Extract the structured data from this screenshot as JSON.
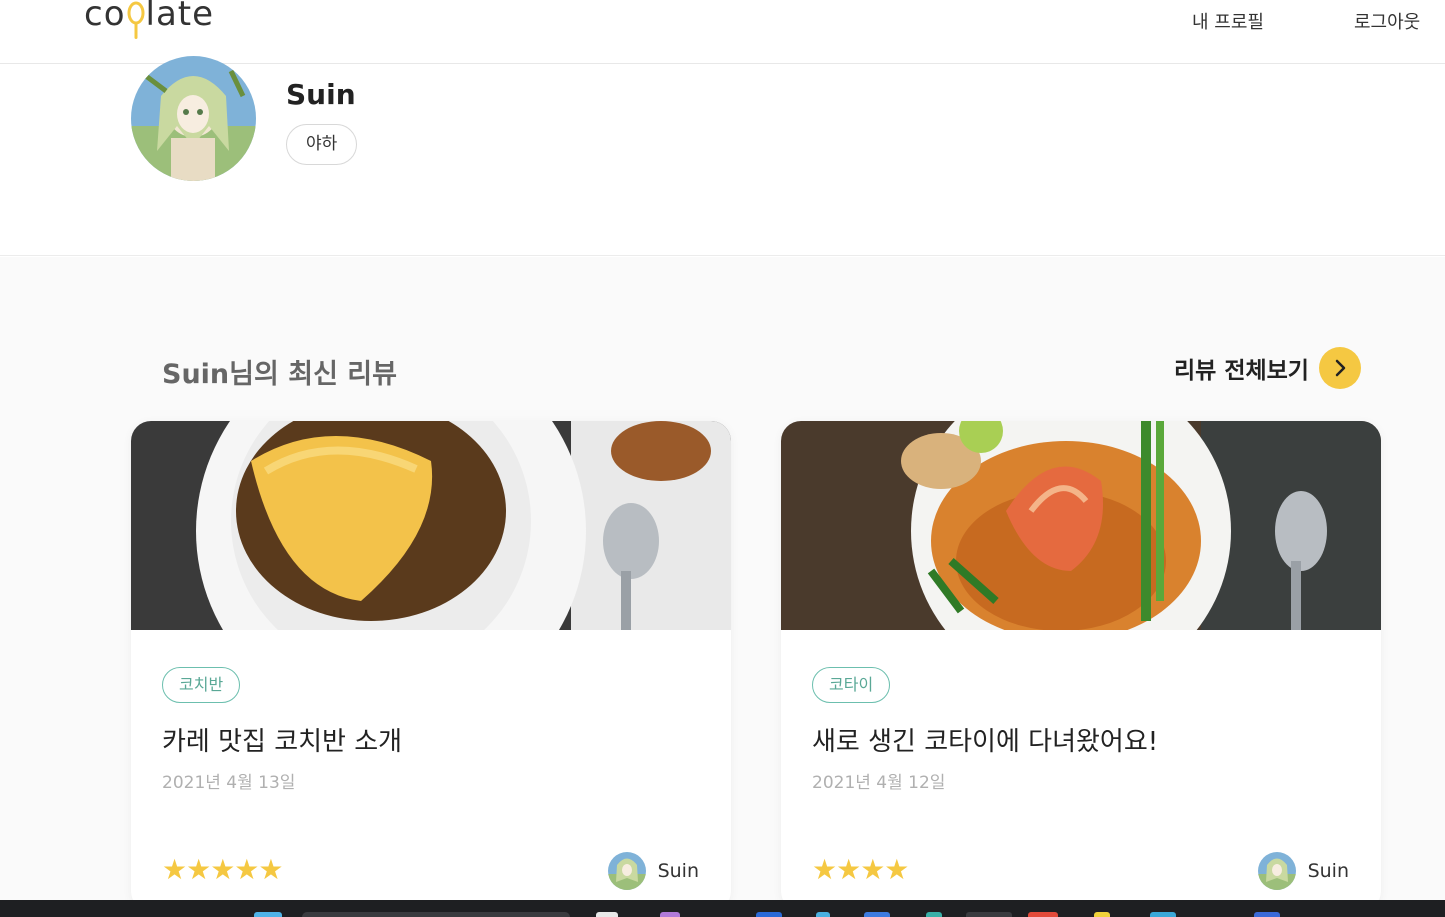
{
  "header": {
    "logo": "coolate",
    "nav": {
      "profile": "내 프로필",
      "logout": "로그아웃"
    }
  },
  "profile": {
    "name": "Suin",
    "bio": "야하"
  },
  "reviews": {
    "title": "Suin님의 최신 리뷰",
    "see_all_label": "리뷰 전체보기",
    "cards": [
      {
        "tag": "코치반",
        "title": "카레 맛집 코치반 소개",
        "date": "2021년 4월 13일",
        "stars": "★★★★★",
        "rating": 5,
        "author": "Suin"
      },
      {
        "tag": "코타이",
        "title": "새로 생긴 코타이에 다녀왔어요!",
        "date": "2021년 4월 12일",
        "stars": "★★★★",
        "rating": 4,
        "author": "Suin"
      }
    ]
  },
  "colors": {
    "accent": "#f5c842",
    "tag": "#6cbfae",
    "text": "#222222",
    "muted": "#b0b0b0"
  }
}
